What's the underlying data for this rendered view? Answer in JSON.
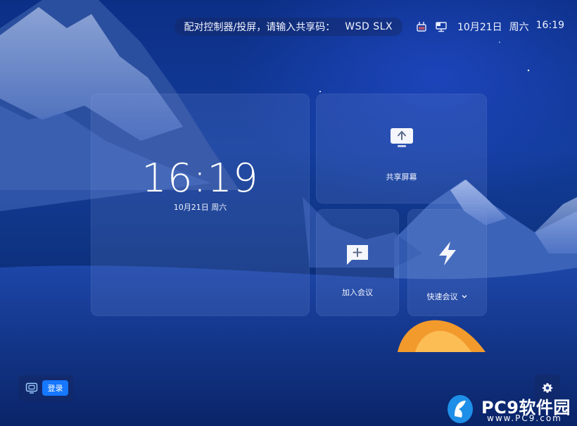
{
  "topbar": {
    "pair_prompt": "配对控制器/投屏，请输入共享码：",
    "pair_code": "WSD SLX",
    "date": "10月21日",
    "weekday": "周六",
    "time": "16:19",
    "icons": [
      "device-status-icon",
      "screen-status-icon"
    ]
  },
  "clock": {
    "time": "16:19",
    "date": "10月21日 周六"
  },
  "actions": {
    "share_screen": "共享屏幕",
    "join_meeting": "加入会议",
    "quick_meeting": "快速会议"
  },
  "login": {
    "button_label": "登录"
  },
  "watermark": {
    "brand": "PC9软件园",
    "url": "www.PC9.com"
  },
  "colors": {
    "accent": "#1677ff",
    "background": "#0f3585",
    "tent_glow": "#ff9628"
  }
}
